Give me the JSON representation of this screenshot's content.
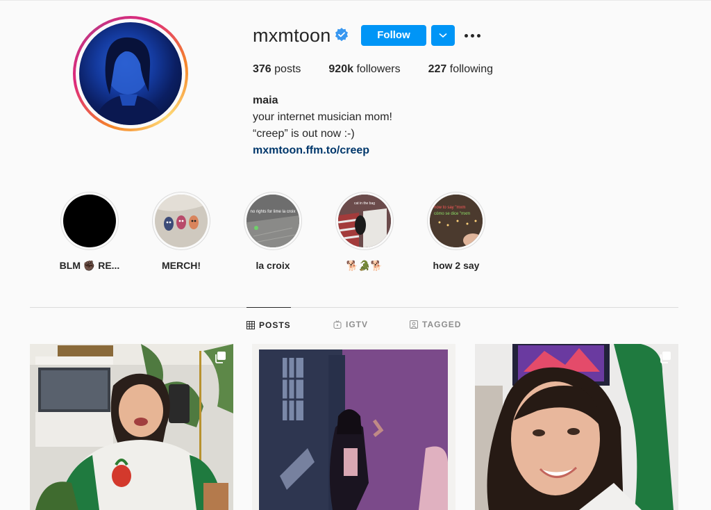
{
  "profile": {
    "username": "mxmtoon",
    "follow_label": "Follow",
    "stats": [
      {
        "value": "376",
        "label": "posts"
      },
      {
        "value": "920k",
        "label": "followers"
      },
      {
        "value": "227",
        "label": "following"
      }
    ],
    "bio": {
      "name": "maia",
      "line1": "your internet musician mom!",
      "line2": "“creep” is out now :-)",
      "link": "mxmtoon.ffm.to/creep"
    }
  },
  "highlights": [
    {
      "label": "BLM ✊🏿 RE..."
    },
    {
      "label": "MERCH!"
    },
    {
      "label": "la croix"
    },
    {
      "label": "🐕🐊🐕"
    },
    {
      "label": "how 2 say"
    }
  ],
  "highlight_texts": {
    "la_croix": "no rights for lime la croix",
    "cat": "cat in the bag",
    "how2say_1": "how to say \"mxm",
    "how2say_2": "cómo se dice \"mxm"
  },
  "tabs": [
    {
      "label": "POSTS",
      "icon": "grid-icon",
      "active": true
    },
    {
      "label": "IGTV",
      "icon": "igtv-icon",
      "active": false
    },
    {
      "label": "TAGGED",
      "icon": "tagged-icon",
      "active": false
    }
  ],
  "colors": {
    "accent": "#0095f6",
    "link": "#00376b",
    "text": "#262626",
    "muted": "#8e8e8e",
    "background": "#fafafa"
  }
}
